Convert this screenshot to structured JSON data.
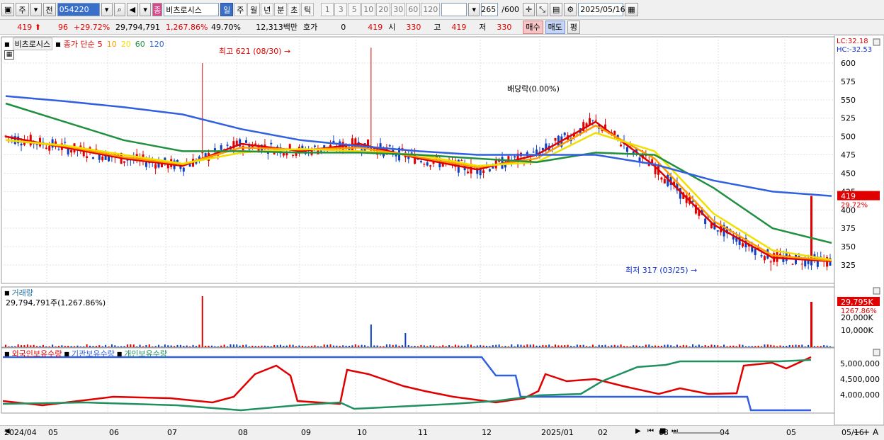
{
  "toolbar": {
    "type_label": "주",
    "prev_label": "전",
    "code": "054220",
    "stock_name": "비츠로시스",
    "name_badge": "종",
    "periods": [
      "일",
      "주",
      "월",
      "년",
      "분",
      "초",
      "틱"
    ],
    "selected_period": "일",
    "minutes": [
      "1",
      "3",
      "5",
      "10",
      "20",
      "30",
      "60",
      "120"
    ],
    "count": "265",
    "count_total": "/600",
    "date": "2025/05/16"
  },
  "info": {
    "price": "419",
    "change": "96",
    "change_pct": "+29.72%",
    "volume": "29,794,791",
    "vol_pct": "1,267.86%",
    "turnover": "49.70%",
    "amount": "12,313백만",
    "quote_label": "호가",
    "quote_value": "0",
    "quote_price": "419",
    "open_label": "시",
    "open_value": "330",
    "high_label": "고",
    "high_value": "419",
    "low_label": "저",
    "low_value": "330",
    "buy_label": "매수",
    "sell_label": "매도",
    "eval_label": "평"
  },
  "legend": {
    "name": "비츠로시스",
    "ma_label": "종가 단순",
    "ma": [
      {
        "period": "5",
        "color": "#e00000"
      },
      {
        "period": "10",
        "color": "#ff9a00"
      },
      {
        "period": "20",
        "color": "#f0e000"
      },
      {
        "period": "60",
        "color": "#209040"
      },
      {
        "period": "120",
        "color": "#3060e0"
      }
    ],
    "lc": "LC:32.18",
    "hc": "HC:-32.53"
  },
  "annotations": {
    "high": "최고 621 (08/30)",
    "low": "최저 317 (03/25)",
    "dividend": "배당락(0.00%)"
  },
  "price_axis": {
    "ticks": [
      "600",
      "575",
      "550",
      "525",
      "500",
      "475",
      "450",
      "425",
      "400",
      "375",
      "350",
      "325"
    ],
    "last_price": "419",
    "last_pct": "29.72%"
  },
  "volume_pane": {
    "title": "거래량",
    "value": "29,794,791주(1,267.86%)",
    "axis_ticks": [
      "20,000K",
      "10,000K"
    ],
    "last": "29,795K",
    "last_pct": "1267.86%"
  },
  "holding_pane": {
    "titles": [
      "외국인보유수량",
      "기관보유수량",
      "개인보유수량"
    ],
    "colors": [
      "#e00000",
      "#3060e0",
      "#209060"
    ],
    "axis_ticks": [
      "5,000,000",
      "4,500,000",
      "4,000,000"
    ]
  },
  "date_axis": [
    "2024/04",
    "05",
    "06",
    "07",
    "08",
    "09",
    "10",
    "11",
    "12",
    "2025/01",
    "02",
    "03",
    "04",
    "05",
    "05/16"
  ],
  "chart_data": {
    "type": "line",
    "title": "비츠로시스",
    "x": [
      "2024/04",
      "05",
      "06",
      "07",
      "08",
      "09",
      "10",
      "11",
      "12",
      "2025/01",
      "02",
      "03",
      "04",
      "05",
      "05/16"
    ],
    "series": [
      {
        "name": "5",
        "values": [
          500,
          485,
          470,
          460,
          490,
          480,
          490,
          470,
          455,
          475,
          520,
          460,
          380,
          335,
          330
        ]
      },
      {
        "name": "10",
        "values": [
          495,
          487,
          472,
          462,
          485,
          482,
          485,
          472,
          458,
          470,
          515,
          470,
          385,
          338,
          331
        ]
      },
      {
        "name": "20",
        "values": [
          495,
          488,
          475,
          463,
          478,
          483,
          480,
          475,
          460,
          465,
          505,
          480,
          395,
          345,
          332
        ]
      },
      {
        "name": "60",
        "values": [
          545,
          520,
          495,
          480,
          480,
          478,
          478,
          475,
          470,
          465,
          478,
          475,
          430,
          375,
          355
        ]
      },
      {
        "name": "120",
        "values": [
          555,
          548,
          540,
          530,
          510,
          495,
          487,
          480,
          475,
          475,
          475,
          462,
          440,
          425,
          419
        ]
      }
    ],
    "ylim": [
      317,
      621
    ],
    "annotations": [
      "최고 621 (08/30)",
      "최저 317 (03/25)",
      "배당락(0.00%)"
    ]
  }
}
